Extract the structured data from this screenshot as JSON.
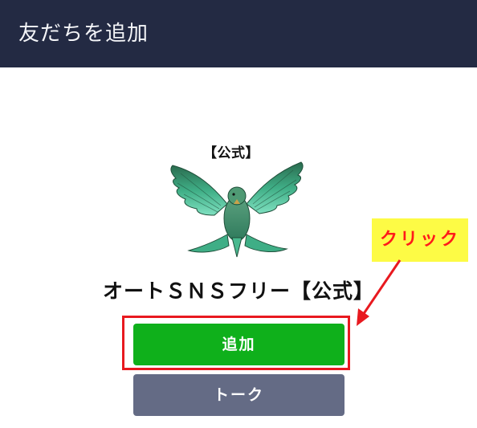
{
  "header": {
    "title": "友だちを追加"
  },
  "profile": {
    "avatar_badge": "【公式】",
    "avatar_icon": "bird-icon",
    "name": "オートＳＮＳフリー【公式】"
  },
  "actions": {
    "add_label": "追加",
    "talk_label": "トーク"
  },
  "annotation": {
    "callout_text": "クリック",
    "arrow_icon": "arrow-icon"
  },
  "colors": {
    "header_bg": "#232a43",
    "add_button": "#0fb01b",
    "talk_button": "#646b85",
    "highlight_border": "#e8191f",
    "callout_bg": "#fdfb45",
    "callout_text": "#ff1a1a"
  }
}
